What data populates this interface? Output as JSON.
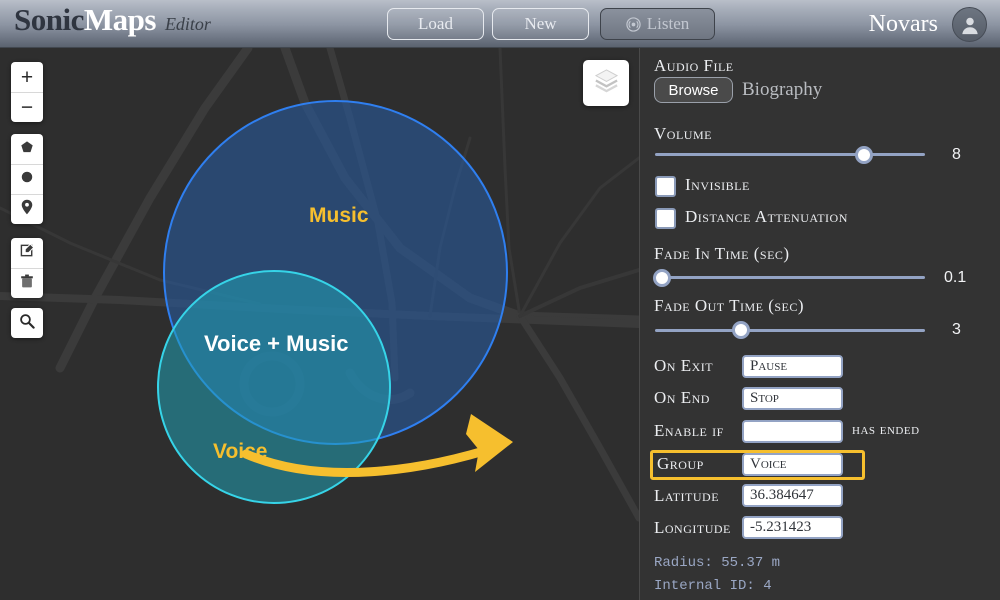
{
  "header": {
    "logo_primary": "Sonic",
    "logo_secondary": "Maps",
    "logo_suffix": "Editor",
    "buttons": {
      "load": "Load",
      "new": "New",
      "listen": "Listen"
    },
    "listen_icon": "broadcast-icon",
    "user_name": "Novars",
    "avatar_icon": "user-avatar-icon"
  },
  "map": {
    "toolbar": {
      "zoom_in": "+",
      "zoom_out": "−",
      "polygon_icon": "polygon-icon",
      "circle_icon": "circle-icon",
      "marker_icon": "marker-pin-icon",
      "edit_icon": "edit-icon",
      "delete_icon": "trash-icon",
      "search_icon": "search-icon"
    },
    "layers_icon": "layers-icon",
    "zones": [
      {
        "label": "Music",
        "fill": "#285ca0",
        "stroke": "#2f7ff0"
      },
      {
        "label": "Voice",
        "fill": "#21a0b4",
        "stroke": "#36d4e8"
      }
    ],
    "overlap_label": "Voice + Music",
    "annotation_arrow_color": "#f6bf2e"
  },
  "panel": {
    "audio_file_label": "Audio File",
    "browse_label": "Browse",
    "audio_filename": "Biography",
    "volume_label": "Volume",
    "volume_value": "8",
    "volume_percent": 77,
    "invisible_label": "Invisible",
    "invisible_checked": false,
    "distance_attenuation_label": "Distance Attenuation",
    "distance_attenuation_checked": false,
    "fade_in_label": "Fade In Time (sec)",
    "fade_in_value": "0.1",
    "fade_in_percent": 2,
    "fade_out_label": "Fade Out Time (sec)",
    "fade_out_value": "3",
    "fade_out_percent": 31,
    "on_exit_label": "On Exit",
    "on_exit_value": "Pause",
    "on_end_label": "On End",
    "on_end_value": "Stop",
    "enable_if_label": "Enable if",
    "enable_if_value": "",
    "has_ended_label": "has ended",
    "group_label": "Group",
    "group_value": "Voice",
    "group_highlight_color": "#f6bf2e",
    "latitude_label": "Latitude",
    "latitude_value": "36.384647",
    "longitude_label": "Longitude",
    "longitude_value": "-5.231423",
    "radius_info": "Radius: 55.37 m",
    "internal_id_info": "Internal ID: 4"
  }
}
